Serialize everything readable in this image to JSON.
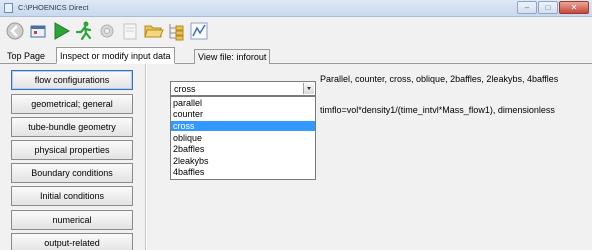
{
  "window": {
    "title": "C:\\PHOENICS Direct",
    "controls": [
      "minimize",
      "maximize",
      "close"
    ]
  },
  "toolbar": {
    "buttons": [
      {
        "name": "back-icon"
      },
      {
        "name": "window-icon"
      },
      {
        "name": "run-icon"
      },
      {
        "name": "run-person-icon"
      },
      {
        "name": "settings-icon"
      },
      {
        "name": "page-icon"
      },
      {
        "name": "folder-open-icon"
      },
      {
        "name": "tree-icon"
      },
      {
        "name": "chart-icon"
      }
    ]
  },
  "tabs": [
    {
      "label": "Top Page",
      "active": false
    },
    {
      "label": "Inspect or modify input data",
      "active": true
    },
    {
      "label": "View file: inforout",
      "active": false
    }
  ],
  "nav": {
    "buttons": [
      {
        "label": "flow configurations",
        "active": true
      },
      {
        "label": "geometrical; general",
        "active": false
      },
      {
        "label": "tube-bundle geometry",
        "active": false
      },
      {
        "label": "physical properties",
        "active": false
      },
      {
        "label": "Boundary conditions",
        "active": false
      },
      {
        "label": "Initial conditions",
        "active": false
      },
      {
        "label": "numerical",
        "active": false
      },
      {
        "label": "output-related",
        "active": false
      }
    ]
  },
  "config": {
    "selected": "cross",
    "options": [
      "parallel",
      "counter",
      "cross",
      "oblique",
      "2baffles",
      "2leakybs",
      "4baffles"
    ],
    "description": "Parallel, counter, cross, oblique, 2baffles, 2leakybs, 4baffles",
    "formula": "timflo=vol*density1/(time_intvl*Mass_flow1), dimensionless"
  },
  "colors": {
    "selection": "#3399ff",
    "active_border": "#3d6fb8",
    "panel_bg": "#f1f1f1"
  }
}
